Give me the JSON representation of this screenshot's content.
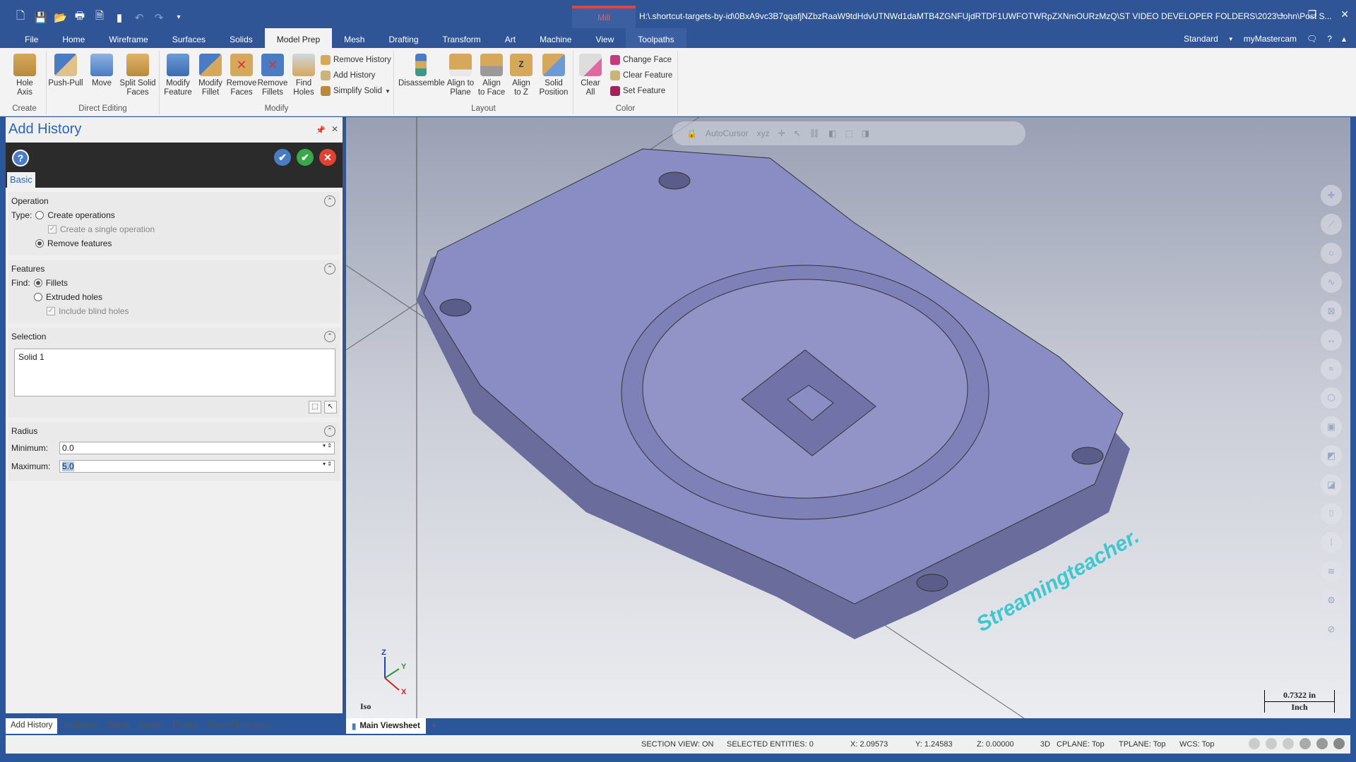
{
  "titlebar": {
    "quick_access": [
      "new-file-icon",
      "save-icon",
      "open-icon",
      "print-icon",
      "save-as-icon",
      "merge-icon",
      "undo-icon",
      "redo-icon",
      "customize-icon"
    ],
    "context_tab": "Mill",
    "path": "H:\\.shortcut-targets-by-id\\0BxA9vc3B7qqafjNZbzRaaW9tdHdvUTNWd1daMTB4ZGNFUjdRTDF1UWFOTWRpZXNmOURzMzQ\\ST VIDEO DEVELOPER FOLDERS\\2023\\John\\Post S...",
    "minimize": "–",
    "restore": "❐",
    "close": "✕"
  },
  "menubar": {
    "tabs": [
      "File",
      "Home",
      "Wireframe",
      "Surfaces",
      "Solids",
      "Model Prep",
      "Mesh",
      "Drafting",
      "Transform",
      "Art",
      "Machine",
      "View",
      "Toolpaths"
    ],
    "active": "Model Prep",
    "workspace": "Standard",
    "my_mastercam": "myMastercam"
  },
  "ribbon": {
    "groups": {
      "create": {
        "label": "Create",
        "buttons": [
          "Hole\nAxis"
        ]
      },
      "direct_editing": {
        "label": "Direct Editing",
        "buttons": [
          "Push-Pull",
          "Move",
          "Split Solid\nFaces"
        ]
      },
      "modify": {
        "label": "Modify",
        "buttons": [
          "Modify\nFeature",
          "Modify\nFillet",
          "Remove\nFaces",
          "Remove\nFillets",
          "Find\nHoles"
        ],
        "small": [
          "Remove History",
          "Add History",
          "Simplify Solid"
        ]
      },
      "layout": {
        "label": "Layout",
        "buttons": [
          "Disassemble",
          "Align to\nPlane",
          "Align\nto Face",
          "Align\nto Z",
          "Solid\nPosition"
        ]
      },
      "color": {
        "label": "Color",
        "buttons": [
          "Clear\nAll"
        ],
        "small": [
          "Change Face",
          "Clear Feature",
          "Set Feature"
        ]
      }
    }
  },
  "panel": {
    "title": "Add History",
    "tab": "Basic",
    "operation": {
      "header": "Operation",
      "type_label": "Type:",
      "create_operations": "Create operations",
      "create_single": "Create a single operation",
      "remove_features": "Remove features",
      "selected": "Remove features"
    },
    "features": {
      "header": "Features",
      "find_label": "Find:",
      "fillets": "Fillets",
      "extruded_holes": "Extruded holes",
      "include_blind": "Include blind holes",
      "selected": "Fillets"
    },
    "selection": {
      "header": "Selection",
      "items": [
        "Solid 1"
      ]
    },
    "radius": {
      "header": "Radius",
      "min_label": "Minimum:",
      "min_value": "0.0",
      "max_label": "Maximum:",
      "max_value": "5.0"
    }
  },
  "bottom_tabs": [
    "Add History",
    "Toolpaths",
    "Solids",
    "Levels",
    "Planes",
    "Recent Functions"
  ],
  "viewport": {
    "autocursor": "AutoCursor",
    "view_label": "Iso",
    "scale_value": "0.7322 in",
    "scale_unit": "Inch",
    "watermark": "Streamingteacher.",
    "axes": {
      "x": "X",
      "y": "Y",
      "z": "Z"
    },
    "colors": {
      "solid": "#8a8cc4",
      "text": "#3fc6cf"
    }
  },
  "viewsheets": {
    "active": "Main Viewsheet",
    "add": "+"
  },
  "status": {
    "section_view": "SECTION VIEW: ON",
    "selected": "SELECTED ENTITIES: 0",
    "x": "X:  2.09573",
    "y": "Y:  1.24583",
    "z": "Z:  0.00000",
    "mode": "3D",
    "cplane": "CPLANE: Top",
    "tplane": "TPLANE: Top",
    "wcs": "WCS: Top"
  }
}
